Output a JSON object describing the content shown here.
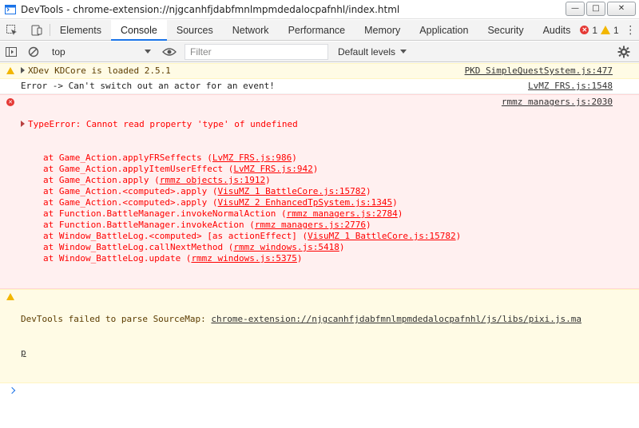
{
  "window": {
    "title": "DevTools - chrome-extension://njgcanhfjdabfmnlmpmdedalocpafnhl/index.html",
    "minimize": "—",
    "maximize": "□",
    "close": "✕"
  },
  "tabs": [
    {
      "label": "Elements"
    },
    {
      "label": "Console"
    },
    {
      "label": "Sources"
    },
    {
      "label": "Network"
    },
    {
      "label": "Performance"
    },
    {
      "label": "Memory"
    },
    {
      "label": "Application"
    },
    {
      "label": "Security"
    },
    {
      "label": "Audits"
    }
  ],
  "counts": {
    "errors": "1",
    "warnings": "1"
  },
  "console_toolbar": {
    "context": "top",
    "filter_placeholder": "Filter",
    "levels": "Default levels"
  },
  "messages": [
    {
      "level": "warn",
      "text": "XDev KDCore is loaded 2.5.1",
      "source": "PKD SimpleQuestSystem.js:477"
    },
    {
      "level": "log",
      "text": "Error -> Can't switch out an actor for an event!",
      "source": "LvMZ FRS.js:1548"
    },
    {
      "level": "error",
      "text": "TypeError: Cannot read property 'type' of undefined",
      "source": "rmmz managers.js:2030",
      "stack": [
        {
          "pre": "at Game_Action.applyFRSeffects (",
          "link": "LvMZ FRS.js:986",
          "post": ")"
        },
        {
          "pre": "at Game_Action.applyItemUserEffect (",
          "link": "LvMZ FRS.js:942",
          "post": ")"
        },
        {
          "pre": "at Game_Action.apply (",
          "link": "rmmz objects.js:1912",
          "post": ")"
        },
        {
          "pre": "at Game_Action.<computed>.apply (",
          "link": "VisuMZ 1 BattleCore.js:15782",
          "post": ")"
        },
        {
          "pre": "at Game_Action.<computed>.apply (",
          "link": "VisuMZ 2 EnhancedTpSystem.js:1345",
          "post": ")"
        },
        {
          "pre": "at Function.BattleManager.invokeNormalAction (",
          "link": "rmmz managers.js:2784",
          "post": ")"
        },
        {
          "pre": "at Function.BattleManager.invokeAction (",
          "link": "rmmz managers.js:2776",
          "post": ")"
        },
        {
          "pre": "at Window_BattleLog.<computed> [as actionEffect] (",
          "link": "VisuMZ 1 BattleCore.js:15782",
          "post": ")"
        },
        {
          "pre": "at Window_BattleLog.callNextMethod (",
          "link": "rmmz windows.js:5418",
          "post": ")"
        },
        {
          "pre": "at Window_BattleLog.update (",
          "link": "rmmz windows.js:5375",
          "post": ")"
        }
      ]
    },
    {
      "level": "warn",
      "text": "DevTools failed to parse SourceMap: ",
      "link_line1": "chrome-extension://njgcanhfjdabfmnlmpmdedalocpafnhl/js/libs/pixi.js.ma",
      "link_line2": "p"
    }
  ],
  "colors": {
    "accent": "#1a73e8",
    "error_text": "#ff0000",
    "error_bg": "#fff0f0",
    "warn_bg": "#fffbe5",
    "warn_icon": "#f2b600"
  }
}
